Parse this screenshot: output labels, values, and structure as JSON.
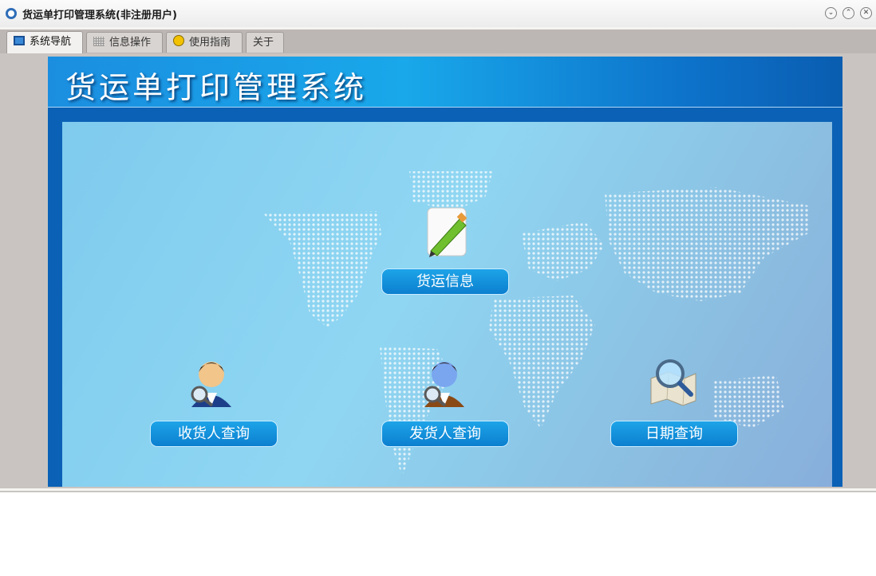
{
  "window": {
    "title": "货运单打印管理系统(非注册用户)",
    "controls": {
      "minimize": "⌄",
      "maximize": "⌃",
      "close": "✕"
    }
  },
  "tabs": [
    {
      "label": "系统导航",
      "icon": "monitor-icon",
      "active": true
    },
    {
      "label": "信息操作",
      "icon": "grid-icon",
      "active": false
    },
    {
      "label": "使用指南",
      "icon": "help-icon",
      "active": false
    },
    {
      "label": "关于",
      "icon": "",
      "active": false
    }
  ],
  "banner": {
    "title": "货运单打印管理系统"
  },
  "actions": {
    "freight_info": {
      "label": "货运信息",
      "icon": "notepad-pencil-icon"
    },
    "receiver_query": {
      "label": "收货人查询",
      "icon": "person-search-icon"
    },
    "sender_query": {
      "label": "发货人查询",
      "icon": "person-search-icon"
    },
    "date_query": {
      "label": "日期查询",
      "icon": "map-magnifier-icon"
    }
  },
  "colors": {
    "banner": "#19a8ea",
    "panel": "#0b61b5",
    "button": "#0c7fcf",
    "stage": "#8fd6f2"
  }
}
